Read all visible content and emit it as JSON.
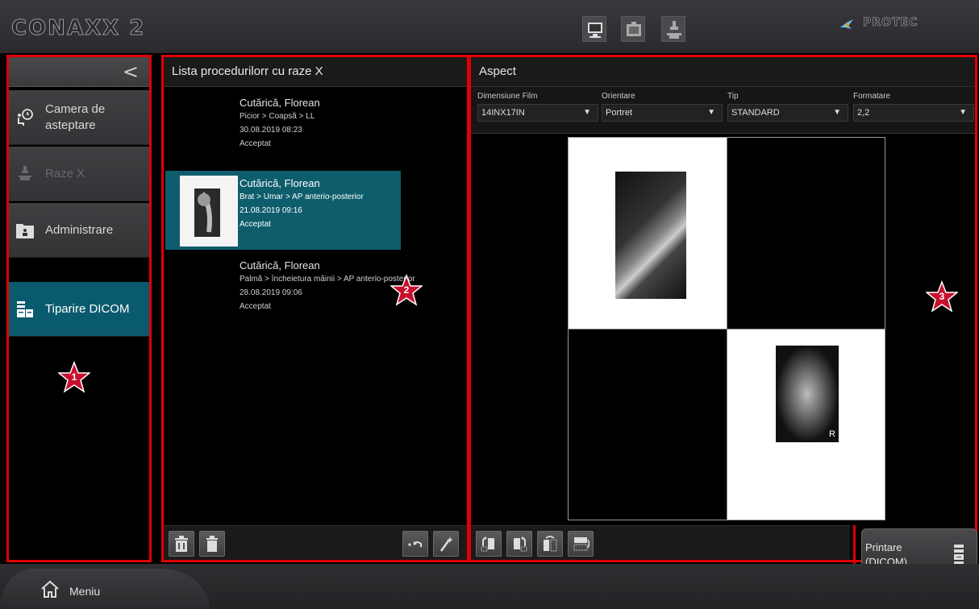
{
  "app": {
    "title": "CONAXX 2",
    "brand": "PROTEC"
  },
  "topbar": {
    "icons": [
      "monitor-icon",
      "cassette-icon",
      "xray-station-icon"
    ]
  },
  "sidebar": {
    "items": [
      {
        "label": "Camera de asteptare",
        "icon": "waiting-room-icon",
        "state": "normal"
      },
      {
        "label": "Raze X",
        "icon": "xray-icon",
        "state": "disabled"
      },
      {
        "label": "Administrare",
        "icon": "admin-folder-icon",
        "state": "normal"
      },
      {
        "label": "Tiparire DICOM",
        "icon": "dicom-print-icon",
        "state": "active"
      }
    ]
  },
  "procedures": {
    "title": "Lista procedurilorr cu raze X",
    "items": [
      {
        "patient": "Cutărică, Florean",
        "body_part": "Picior > Coapsă > LL",
        "date": "30.08.2019 08:23",
        "status": "Acceptat",
        "selected": false
      },
      {
        "patient": "Cutărică, Florean",
        "body_part": "Brat > Umar > AP anterio-posterior",
        "date": "21.08.2019 09:16",
        "status": "Acceptat",
        "selected": true
      },
      {
        "patient": "Cutărică, Florean",
        "body_part": "Palmă > încheietura mâinii > AP anterio-posterior",
        "date": "28.08.2019 09:06",
        "status": "Acceptat",
        "selected": false
      }
    ]
  },
  "aspect": {
    "title": "Aspect",
    "film_size": {
      "label": "Dimensiune Film",
      "value": "14INX17IN"
    },
    "orientation": {
      "label": "Orientare",
      "value": "Portret"
    },
    "type": {
      "label": "Tip",
      "value": "STANDARD"
    },
    "format": {
      "label": "Formatare",
      "value": "2,2"
    },
    "preview_marker": "R"
  },
  "print_button": {
    "label": "Printare (DICOM)"
  },
  "menu": {
    "label": "Meniu"
  },
  "markers": [
    "1",
    "2",
    "3"
  ],
  "colors": {
    "highlight": "#e00000",
    "selected": "#0d5d6c",
    "active_nav": "#0a5a6e"
  }
}
